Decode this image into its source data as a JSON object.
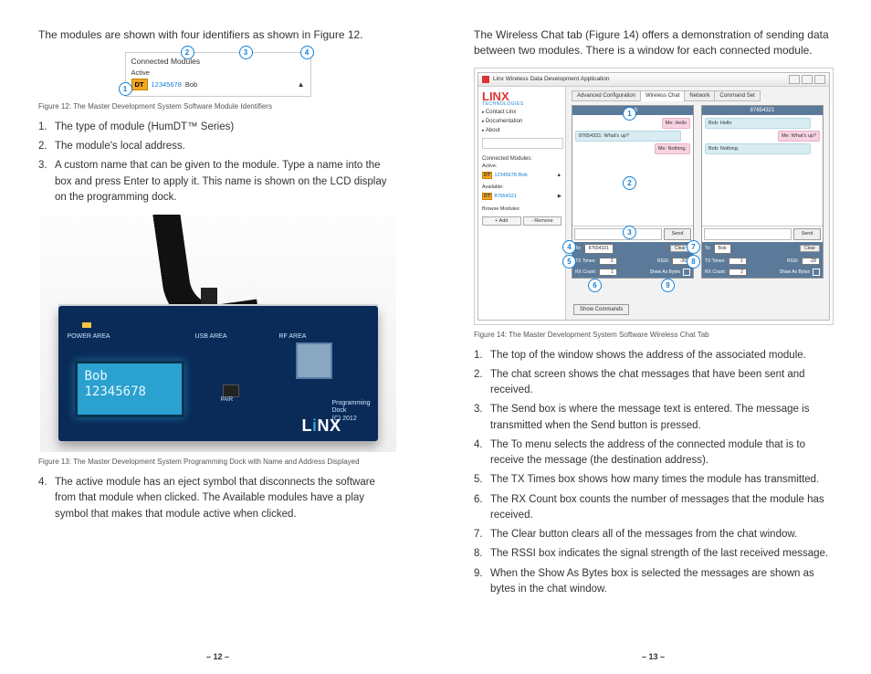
{
  "left": {
    "intro": "The modules are shown with four identifiers as shown in Figure 12.",
    "fig12": {
      "connected": "Connected Modules",
      "active": "Active",
      "badge": "DT",
      "addr": "12345678",
      "name": "Bob",
      "eject": "▲",
      "labels": [
        "1",
        "2",
        "3",
        "4"
      ]
    },
    "caption12": "Figure 12: The Master Development System Software Module Identifiers",
    "list_a": [
      "The type of module (HumDT™ Series)",
      "The module's local address.",
      "A custom name that can be given to the module. Type a name into the box and press Enter to apply it. This name is shown on the LCD display on the programming dock."
    ],
    "fig13": {
      "lcd_line1": "Bob",
      "lcd_line2": "12345678",
      "power": "POWER AREA",
      "usb": "USB AREA",
      "rf": "RF AREA",
      "pair": "PAIR",
      "pd1": "Programming",
      "pd2": "Dock",
      "pd3": "(C) 2012",
      "logo_pre": "L",
      "logo_i": "i",
      "logo_nx": "NX"
    },
    "caption13": "Figure 13: The Master Development System Programming Dock with Name and Address Displayed",
    "list_b": [
      "The active module has an eject symbol that disconnects the software from that module when clicked. The Available modules have a play symbol that makes that module active when clicked."
    ],
    "list_b_start": 4,
    "footer": "– 12 –"
  },
  "right": {
    "intro": "The Wireless Chat tab (Figure 14) offers a demonstration of sending data between two modules. There is a window for each connected module.",
    "fig14": {
      "wintitle": "Linx Wireless Data Development Application",
      "logo": "LINX",
      "logosub": "TECHNOLOGIES",
      "nav": [
        "Contact Linx",
        "Documentation",
        "About"
      ],
      "cm": "Connected Modules:",
      "active": "Active:",
      "available": "Available:",
      "mod_active": {
        "badge": "DT",
        "addr": "12345678",
        "name": "Bob",
        "icon": "▲"
      },
      "mod_avail": {
        "badge": "DT",
        "addr": "87654321",
        "name": "",
        "icon": "▶"
      },
      "browse": "Browse Modules:",
      "btn_add": "+ Add",
      "btn_remove": "- Remove",
      "tabs": [
        "Advanced Configuration",
        "Wireless Chat",
        "Network",
        "Command Set"
      ],
      "chatA": {
        "hdr": "Bob",
        "msgs": [
          {
            "cls": "me",
            "t": "Me: Hello"
          },
          {
            "cls": "them",
            "t": "87654321: What's up?"
          },
          {
            "cls": "me",
            "t": "Me: Nothing."
          }
        ],
        "send": "Send",
        "to": "To:",
        "to_val": "87654321",
        "clear": "Clear",
        "tx": "TX Times:",
        "txv": "3",
        "rx": "RX Count:",
        "rxv": "1",
        "rssi": "RSSI:",
        "rssiv": "-30",
        "show": "Show As Bytes"
      },
      "chatB": {
        "hdr": "87654321",
        "msgs": [
          {
            "cls": "them",
            "t": "Bob: Hello"
          },
          {
            "cls": "me",
            "t": "Me: What's up?"
          },
          {
            "cls": "them",
            "t": "Bob: Nothing."
          }
        ],
        "send": "Send",
        "to": "To:",
        "to_val": "Bob",
        "clear": "Clear",
        "tx": "TX Times:",
        "txv": "1",
        "rx": "RX Count:",
        "rxv": "2",
        "rssi": "RSSI:",
        "rssiv": "-28",
        "show": "Show As Bytes"
      },
      "showcmd": "Show Commands",
      "callouts": [
        "1",
        "2",
        "3",
        "4",
        "5",
        "6",
        "7",
        "8",
        "9"
      ]
    },
    "caption14": "Figure 14: The Master Development System Software Wireless Chat Tab",
    "list": [
      "The top of the window shows the address of the associated module.",
      "The chat screen shows the chat messages that have been sent and received.",
      "The Send box is where the message text is entered. The message is transmitted when the Send button is pressed.",
      "The To menu selects the address of the connected module that is to receive the message (the destination address).",
      "The TX Times box shows how many times the module has transmitted.",
      "The RX Count box counts the number of messages that the module has received.",
      "The Clear button clears all of the messages from the chat window.",
      "The RSSI box indicates the signal strength of the last received message.",
      "When the Show As Bytes box is selected the messages are shown as bytes in the chat window."
    ],
    "footer": "– 13 –"
  }
}
